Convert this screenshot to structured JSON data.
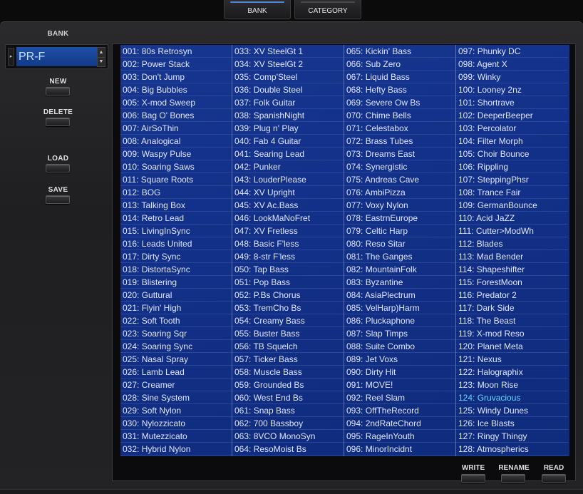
{
  "tabs": [
    {
      "label": "BANK",
      "active": true
    },
    {
      "label": "CATEGORY",
      "active": false
    }
  ],
  "sidebar": {
    "bank_label": "BANK",
    "bank_value": "PR-F",
    "buttons": {
      "new": "NEW",
      "delete": "DELETE",
      "load": "LOAD",
      "save": "SAVE"
    }
  },
  "footer_buttons": {
    "write": "WRITE",
    "rename": "RENAME",
    "read": "READ"
  },
  "selected_patch": "124: Gruvacious",
  "patch_columns": [
    [
      "001: 80s Retrosyn",
      "002: Power Stack",
      "003: Don't Jump",
      "004: Big Bubbles",
      "005: X-mod Sweep",
      "006: Bag O' Bones",
      "007: AirSoThin",
      "008: Analogical",
      "009: Waspy Pulse",
      "010: Soaring Saws",
      "011: Square Roots",
      "012: BOG",
      "013: Talking Box",
      "014: Retro Lead",
      "015: LivingInSync",
      "016: Leads United",
      "017: Dirty Sync",
      "018: DistortaSync",
      "019: Blistering",
      "020: Guttural",
      "021: Flyin' High",
      "022: Soft Tooth",
      "023: Soaring Sqr",
      "024: Soaring Sync",
      "025: Nasal Spray",
      "026: Lamb Lead",
      "027: Creamer",
      "028: Sine System",
      "029: Soft Nylon",
      "030: Nylozzicato",
      "031: Mutezzicato",
      "032: Hybrid Nylon"
    ],
    [
      "033: XV SteelGt 1",
      "034: XV SteelGt 2",
      "035: Comp'Steel",
      "036: Double Steel",
      "037: Folk Guitar",
      "038: SpanishNight",
      "039: Plug n' Play",
      "040: Fab 4 Guitar",
      "041: Searing Lead",
      "042: Punker",
      "043: LouderPlease",
      "044: XV Upright",
      "045: XV Ac.Bass",
      "046: LookMaNoFret",
      "047: XV Fretless",
      "048: Basic F'less",
      "049: 8-str F'less",
      "050: Tap Bass",
      "051: Pop Bass",
      "052: P.Bs Chorus",
      "053: TremCho Bs",
      "054: Creamy Bass",
      "055: Buster Bass",
      "056: TB Squelch",
      "057: Ticker Bass",
      "058: Muscle Bass",
      "059: Grounded Bs",
      "060: West End Bs",
      "061: Snap Bass",
      "062: 700 Bassboy",
      "063: 8VCO MonoSyn",
      "064: ResoMoist Bs"
    ],
    [
      "065: Kickin' Bass",
      "066: Sub Zero",
      "067: Liquid Bass",
      "068: Hefty Bass",
      "069: Severe Ow Bs",
      "070: Chime Bells",
      "071: Celestabox",
      "072: Brass Tubes",
      "073: Dreams East",
      "074: Synergistic",
      "075: Andreas Cave",
      "076: AmbiPizza",
      "077: Voxy Nylon",
      "078: EastrnEurope",
      "079: Celtic Harp",
      "080: Reso Sitar",
      "081: The Ganges",
      "082: MountainFolk",
      "083: Byzantine",
      "084: AsiaPlectrum",
      "085: VelHarp)Harm",
      "086: Pluckaphone",
      "087: Slap Timps",
      "088: Suite Combo",
      "089: Jet Voxs",
      "090: Dirty Hit",
      "091: MOVE!",
      "092: Reel Slam",
      "093: OffTheRecord",
      "094: 2ndRateChord",
      "095: RageInYouth",
      "096: MinorIncidnt"
    ],
    [
      "097: Phunky DC",
      "098: Agent X",
      "099: Winky",
      "100: Looney 2nz",
      "101: Shortrave",
      "102: DeeperBeeper",
      "103: Percolator",
      "104: Filter Morph",
      "105: Choir Bounce",
      "106: Rippling",
      "107: SteppingPhsr",
      "108: Trance Fair",
      "109: GermanBounce",
      "110: Acid JaZZ",
      "111: Cutter>ModWh",
      "112: Blades",
      "113: Mad Bender",
      "114: Shapeshifter",
      "115: ForestMoon",
      "116: Predator 2",
      "117: Dark Side",
      "118: The Beast",
      "119: X-mod Reso",
      "120: Planet Meta",
      "121: Nexus",
      "122: Halographix",
      "123: Moon Rise",
      "124: Gruvacious",
      "125: Windy Dunes",
      "126: Ice Blasts",
      "127: Ringy Thingy",
      "128: Atmospherics"
    ]
  ]
}
